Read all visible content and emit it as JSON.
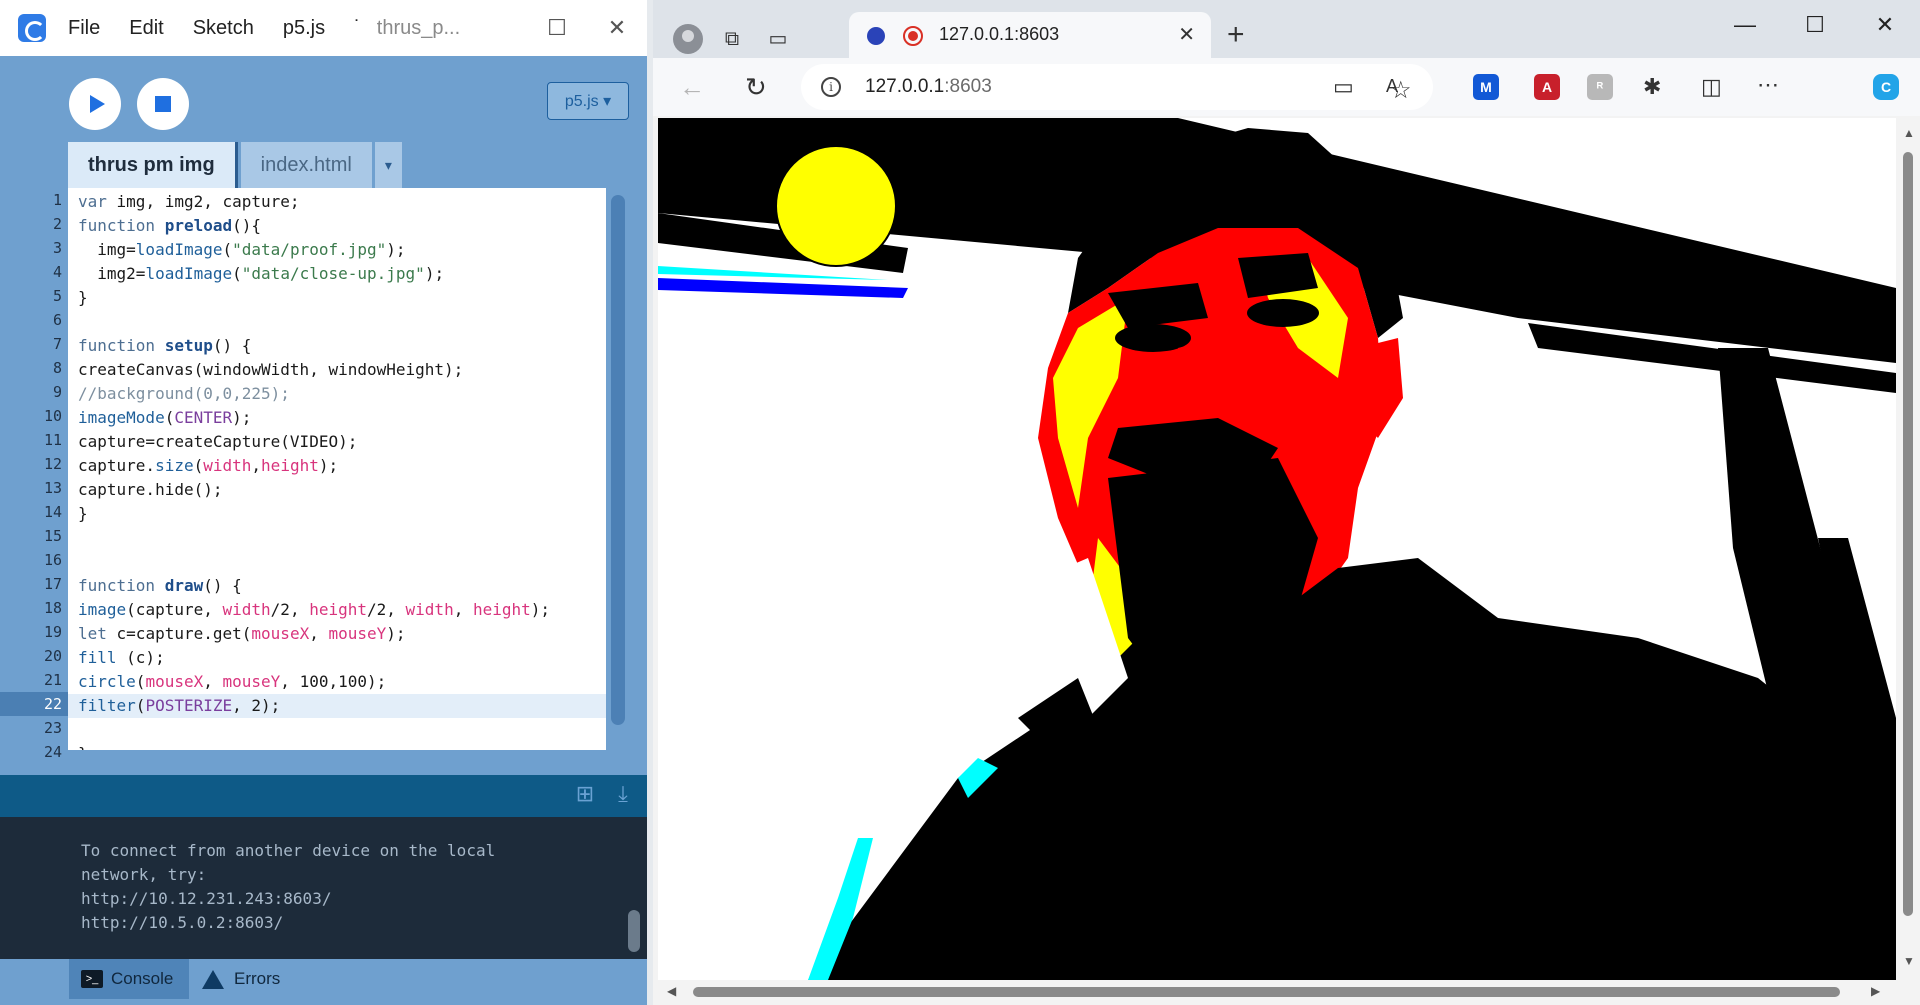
{
  "editor": {
    "menu": [
      "File",
      "Edit",
      "Sketch",
      "p5.js",
      "˙"
    ],
    "window_title": "thrus_p...",
    "mode_select": "p5.js ▾",
    "tabs": [
      {
        "label": "thrus pm img",
        "active": true
      },
      {
        "label": "index.html",
        "active": false
      }
    ],
    "tab_dropdown": "▾",
    "line_numbers": [
      "1",
      "2",
      "3",
      "4",
      "5",
      "6",
      "7",
      "8",
      "9",
      "10",
      "11",
      "12",
      "13",
      "14",
      "15",
      "16",
      "17",
      "18",
      "19",
      "20",
      "21",
      "22",
      "23",
      "24"
    ],
    "current_line": "22",
    "code_lines": [
      "var img, img2, capture;",
      "function preload(){",
      "  img=loadImage(\"data/proof.jpg\");",
      "  img2=loadImage(\"data/close-up.jpg\");",
      "}",
      "",
      "function setup() {",
      "createCanvas(windowWidth, windowHeight);",
      "//background(0,0,225);",
      "imageMode(CENTER);",
      "capture=createCapture(VIDEO);",
      "capture.size(width,height);",
      "capture.hide();",
      "}",
      "",
      "",
      "function draw() {",
      "image(capture, width/2, height/2, width, height);",
      "let c=capture.get(mouseX, mouseY);",
      "fill (c);",
      "circle(mouseX, mouseY, 100,100);",
      "filter(POSTERIZE, 2);",
      "",
      "}"
    ],
    "console_lines": [
      "To connect from another device on the local",
      "network, try:",
      "http://10.12.231.243:8603/",
      "http://10.5.0.2:8603/"
    ],
    "console_tab": "Console",
    "errors_tab": "Errors"
  },
  "browser": {
    "tab_title": "127.0.0.1:8603",
    "tab_close": "✕",
    "new_tab": "+",
    "url_host": "127.0.0.1",
    "url_port": ":8603",
    "win_minimize": "—",
    "win_maximize": "☐",
    "win_close": "✕"
  },
  "colors": {
    "editor_bg": "#6fa0cf",
    "console_bg": "#1d2b3a",
    "accent_blue": "#1f6fe0",
    "poster_red": "#ff0000",
    "poster_yellow": "#ffff00",
    "poster_cyan": "#00ffff",
    "poster_blue": "#0000ff"
  }
}
